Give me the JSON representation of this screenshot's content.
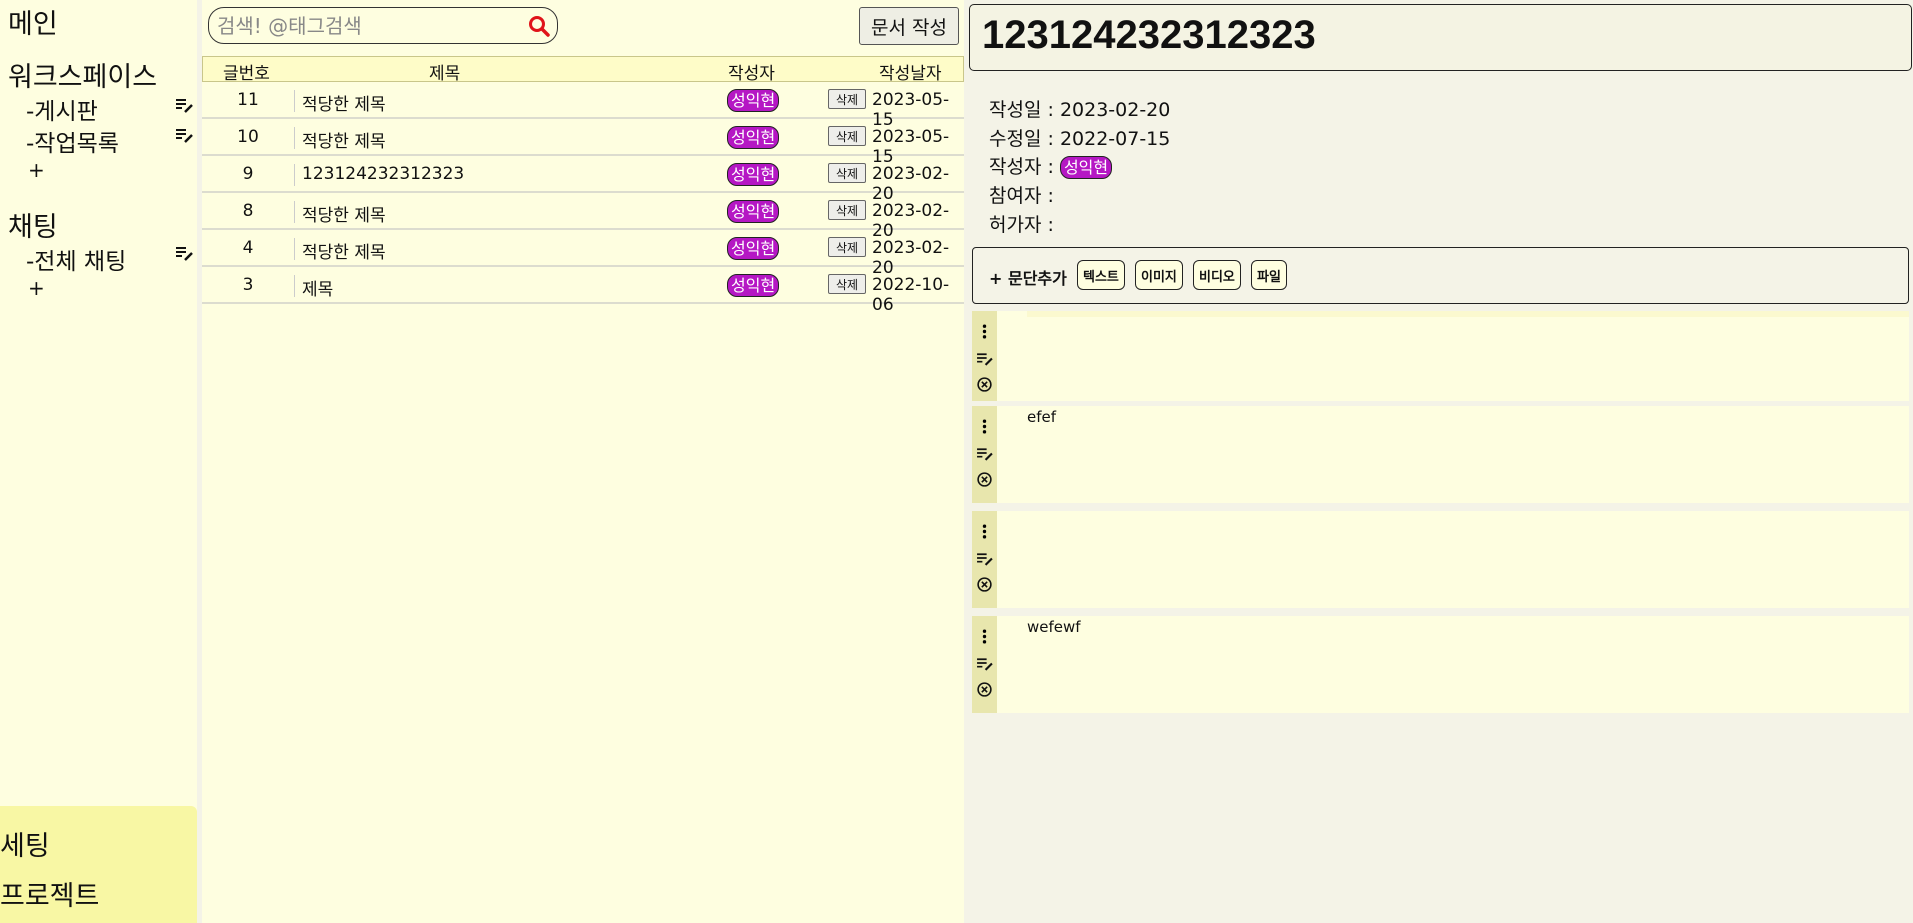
{
  "sidebar": {
    "main_label": "메인",
    "workspace_label": "워크스페이스",
    "workspace_items": [
      {
        "label": "-게시판"
      },
      {
        "label": "-작업목록"
      }
    ],
    "workspace_add": "+",
    "chat_label": "채팅",
    "chat_items": [
      {
        "label": "-전체 채팅"
      }
    ],
    "chat_add": "+",
    "bottom": {
      "settings_label": "세팅",
      "project_label": "프로젝트"
    }
  },
  "list": {
    "search_placeholder": "검색! @태그검색",
    "search_value": "",
    "new_doc_label": "문서 작성",
    "columns": {
      "num": "글번호",
      "title": "제목",
      "author": "작성자",
      "date": "작성날자"
    },
    "delete_label": "삭제",
    "rows": [
      {
        "num": "11",
        "title": "적당한 제목",
        "author": "성익현",
        "date": "2023-05-15"
      },
      {
        "num": "10",
        "title": "적당한 제목",
        "author": "성익현",
        "date": "2023-05-15"
      },
      {
        "num": "9",
        "title": "123124232312323",
        "author": "성익현",
        "date": "2023-02-20"
      },
      {
        "num": "8",
        "title": "적당한 제목",
        "author": "성익현",
        "date": "2023-02-20"
      },
      {
        "num": "4",
        "title": "적당한 제목",
        "author": "성익현",
        "date": "2023-02-20"
      },
      {
        "num": "3",
        "title": "제목",
        "author": "성익현",
        "date": "2022-10-06"
      }
    ]
  },
  "doc": {
    "title": "123124232312323",
    "created_label": "작성일 :",
    "created_value": "2023-02-20",
    "modified_label": "수정일 :",
    "modified_value": "2022-07-15",
    "author_label": "작성자 :",
    "author_value": "성익현",
    "participants_label": "참여자 :",
    "permitted_label": "허가자 :",
    "add_paragraph_label": "+ 문단추가",
    "paragraph_types": [
      "텍스트",
      "이미지",
      "비디오",
      "파일"
    ],
    "blocks": [
      {
        "text": ""
      },
      {
        "text": "efef"
      },
      {
        "text": ""
      },
      {
        "text": "wefewf"
      }
    ]
  },
  "colors": {
    "badge": "#b517c4",
    "panel_bg": "#fefee0",
    "sidebar_bottom": "#f8f7a4",
    "search_icon": "#e0141a"
  }
}
